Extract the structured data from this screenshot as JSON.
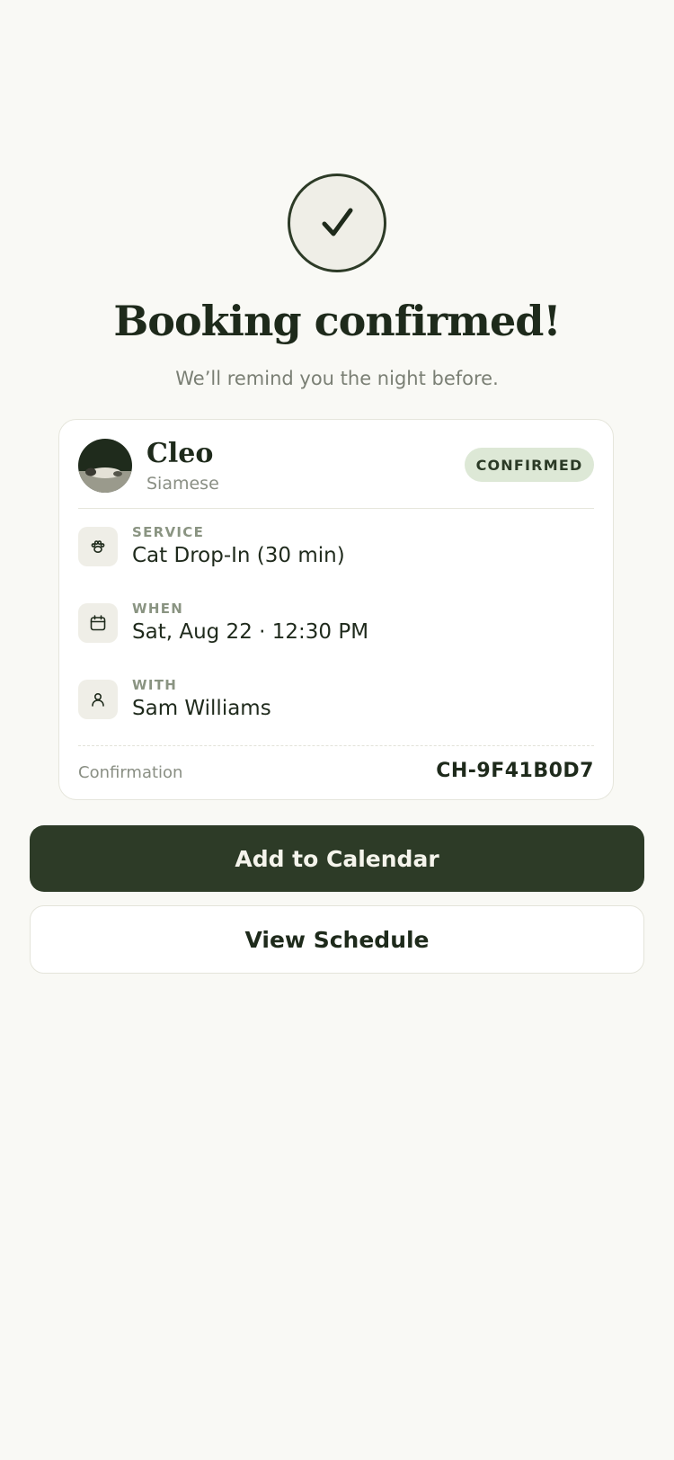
{
  "header": {
    "title": "Booking confirmed!",
    "subtitle": "We’ll remind you the night before."
  },
  "pet": {
    "name": "Cleo",
    "breed": "Siamese",
    "status": "CONFIRMED"
  },
  "details": [
    {
      "icon": "paw-icon",
      "label": "SERVICE",
      "value": "Cat Drop-In (30 min)"
    },
    {
      "icon": "calendar-icon",
      "label": "WHEN",
      "value": "Sat, Aug 22 · 12:30 PM"
    },
    {
      "icon": "person-icon",
      "label": "WITH",
      "value": "Sam Williams"
    }
  ],
  "confirmation": {
    "label": "Confirmation",
    "code": "CH-9F41B0D7"
  },
  "actions": {
    "primary": "Add to Calendar",
    "secondary": "View Schedule"
  },
  "colors": {
    "accent": "#2d3b27",
    "badge_bg": "#dde8d6",
    "background": "#f9f9f5"
  }
}
